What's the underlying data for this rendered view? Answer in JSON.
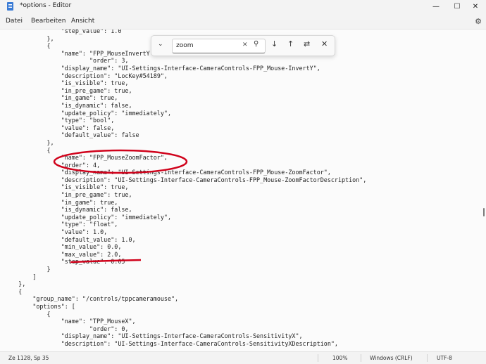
{
  "window": {
    "title": "*options - Editor",
    "minimize": "—",
    "maximize": "☐",
    "close": "✕"
  },
  "menu": {
    "file": "Datei",
    "edit": "Bearbeiten",
    "view": "Ansicht",
    "settings_icon": "gear-icon"
  },
  "find": {
    "value": "zoom",
    "clear": "✕",
    "search": "⚲",
    "next": "↓",
    "prev": "↑",
    "options": "⇄",
    "close": "✕",
    "toggle": "⌄"
  },
  "code_lines": [
    "                \"step_value\": 1.0",
    "            },",
    "            {",
    "                \"name\": \"FPP_MouseInvertY\",",
    "                        \"order\": 3,",
    "                \"display_name\": \"UI-Settings-Interface-CameraControls-FPP_Mouse-InvertY\",",
    "                \"description\": \"LocKey#54189\",",
    "                \"is_visible\": true,",
    "                \"in_pre_game\": true,",
    "                \"in_game\": true,",
    "                \"is_dynamic\": false,",
    "                \"update_policy\": \"immediately\",",
    "                \"type\": \"bool\",",
    "                \"value\": false,",
    "                \"default_value\": false",
    "            },",
    "            {",
    "                \"name\": \"FPP_MouseZoomFactor\",",
    "                \"order\": 4,",
    "                \"display_name\": \"UI-Settings-Interface-CameraControls-FPP_Mouse-ZoomFactor\",",
    "                \"description\": \"UI-Settings-Interface-CameraControls-FPP_Mouse-ZoomFactorDescription\",",
    "                \"is_visible\": true,",
    "                \"in_pre_game\": true,",
    "                \"in_game\": true,",
    "                \"is_dynamic\": false,",
    "                \"update_policy\": \"immediately\",",
    "                \"type\": \"float\",",
    "                \"value\": 1.0,",
    "                \"default_value\": 1.0,",
    "                \"min_value\": 0.0,",
    "                \"max_value\": 2.0,",
    "                \"step_value\": 0.05",
    "            }",
    "        ]",
    "    },",
    "    {",
    "        \"group_name\": \"/controls/tppcameramouse\",",
    "        \"options\": [",
    "            {",
    "                \"name\": \"TPP_MouseX\",",
    "                        \"order\": 0,",
    "                \"display_name\": \"UI-Settings-Interface-CameraControls-SensitivityX\",",
    "                \"description\": \"UI-Settings-Interface-CameraControls-SensitivityXDescription\","
  ],
  "status": {
    "position": "Ze 1128, Sp 35",
    "zoom": "100%",
    "line_ending": "Windows (CRLF)",
    "encoding": "UTF-8"
  },
  "annotation_color": "#d0021b"
}
